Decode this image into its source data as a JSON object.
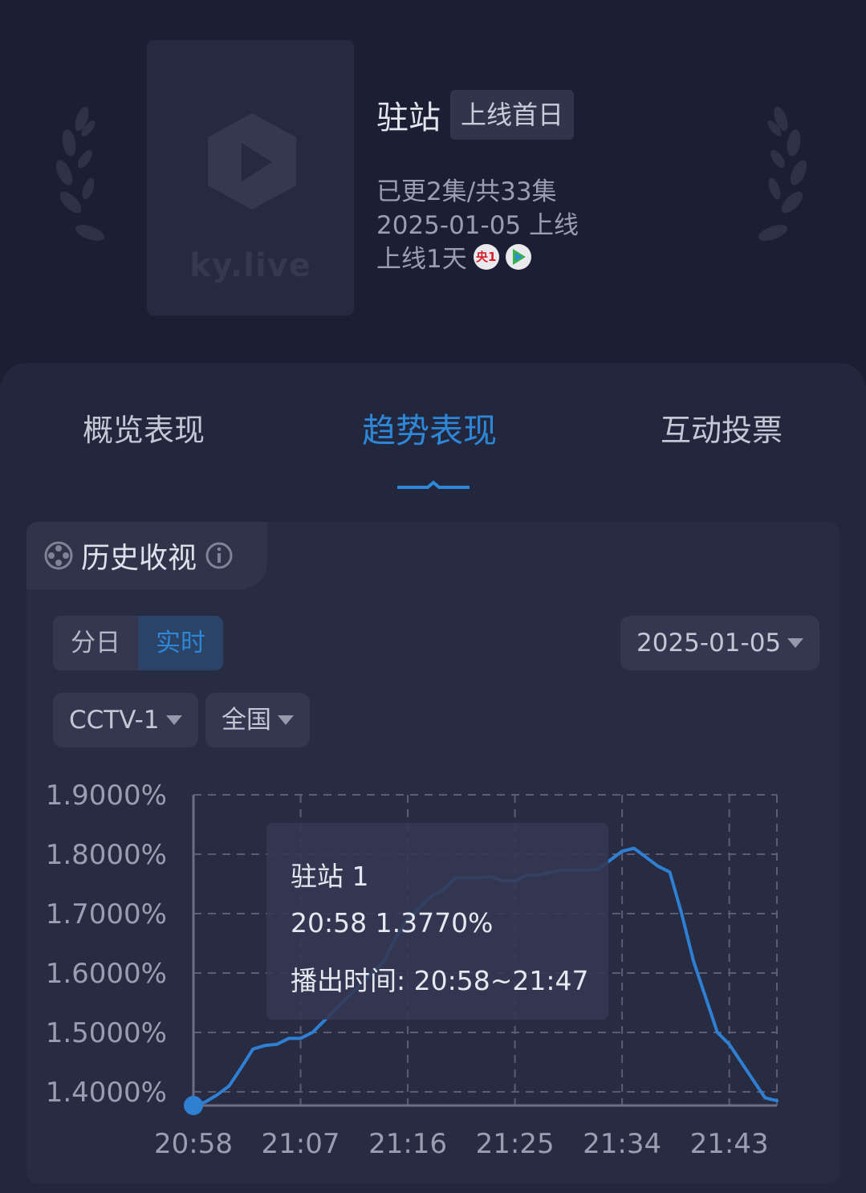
{
  "poster": {
    "logo_text": "ky.live"
  },
  "show": {
    "title": "驻站",
    "badge": "上线首日",
    "episodes": "已更2集/共33集",
    "release": "2025-01-05 上线",
    "online_days": "上线1天",
    "platform_icons": [
      "cctv1-icon",
      "tencent-video-icon"
    ],
    "cctv_icon_text": "央1"
  },
  "tabs": [
    {
      "label": "概览表现"
    },
    {
      "label": "趋势表现",
      "active": true
    },
    {
      "label": "互动投票"
    }
  ],
  "section": {
    "title": "历史收视"
  },
  "controls": {
    "mode_daily": "分日",
    "mode_realtime": "实时",
    "date": "2025-01-05",
    "channel": "CCTV-1",
    "region": "全国"
  },
  "tooltip": {
    "series": "驻站 1",
    "point": "20:58 1.3770%",
    "airtime": "播出时间: 20:58~21:47"
  },
  "colors": {
    "accent": "#2e86d6",
    "line": "#2f7fd3",
    "bg": "#1c1f33"
  },
  "chart_data": {
    "type": "line",
    "ylim": [
      1.377,
      1.9
    ],
    "yticks": [
      "1.9000%",
      "1.8000%",
      "1.7000%",
      "1.6000%",
      "1.5000%",
      "1.4000%"
    ],
    "ytick_values": [
      1.9,
      1.8,
      1.7,
      1.6,
      1.5,
      1.4
    ],
    "xticks": [
      "20:58",
      "21:07",
      "21:16",
      "21:25",
      "21:34",
      "21:43"
    ],
    "x_minutes": [
      0,
      1,
      2,
      3,
      4,
      5,
      6,
      7,
      8,
      9,
      10,
      11,
      12,
      13,
      14,
      15,
      16,
      17,
      18,
      19,
      20,
      21,
      22,
      23,
      24,
      25,
      26,
      27,
      28,
      29,
      30,
      31,
      32,
      33,
      34,
      35,
      36,
      37,
      38,
      39,
      40,
      41,
      42,
      43,
      44,
      45,
      46,
      47,
      48,
      49
    ],
    "grid": true,
    "series": [
      {
        "values": [
          1.377,
          1.383,
          1.395,
          1.41,
          1.44,
          1.472,
          1.478,
          1.48,
          1.49,
          1.49,
          1.5,
          1.52,
          1.54,
          1.56,
          1.58,
          1.6,
          1.62,
          1.66,
          1.69,
          1.71,
          1.73,
          1.74,
          1.76,
          1.76,
          1.76,
          1.762,
          1.755,
          1.755,
          1.765,
          1.765,
          1.77,
          1.773,
          1.773,
          1.773,
          1.775,
          1.79,
          1.805,
          1.81,
          1.795,
          1.78,
          1.77,
          1.7,
          1.62,
          1.56,
          1.5,
          1.48,
          1.45,
          1.42,
          1.39,
          1.385
        ]
      }
    ]
  }
}
